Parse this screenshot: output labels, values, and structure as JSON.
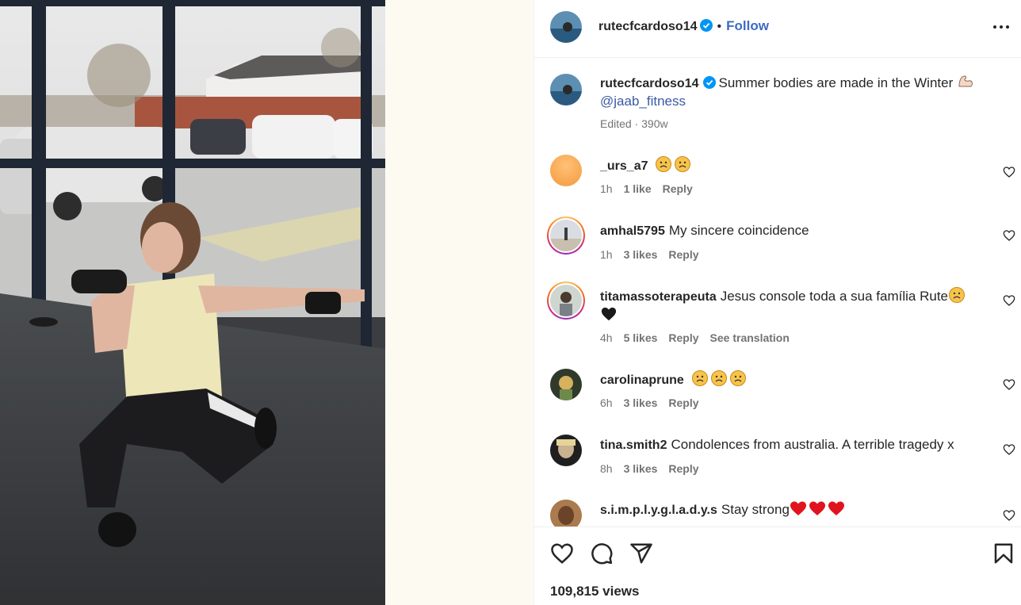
{
  "post": {
    "author": "rutecfcardoso14",
    "follow_label": "Follow",
    "separator": "•",
    "caption": "Summer bodies are made in the Winter",
    "caption_emoji": "flexed-biceps",
    "mention": "@jaab_fitness",
    "caption_meta": "Edited · 390w"
  },
  "comments": [
    {
      "user": "_urs_a7",
      "text": "",
      "emoji": [
        "sad-face",
        "sad-face"
      ],
      "time": "1h",
      "likes": "1 like",
      "reply": "Reply",
      "extra": ""
    },
    {
      "user": "amhal5795",
      "text": "My sincere coincidence",
      "emoji": [],
      "time": "1h",
      "likes": "3 likes",
      "reply": "Reply",
      "extra": ""
    },
    {
      "user": "titamassoterapeuta",
      "text": "Jesus console toda a sua família Rute",
      "emoji": [
        "sad-face",
        "black-heart"
      ],
      "time": "4h",
      "likes": "5 likes",
      "reply": "Reply",
      "extra": "See translation"
    },
    {
      "user": "carolinaprune",
      "text": "",
      "emoji": [
        "sad-face",
        "sad-face",
        "sad-face"
      ],
      "time": "6h",
      "likes": "3 likes",
      "reply": "Reply",
      "extra": ""
    },
    {
      "user": "tina.smith2",
      "text": "Condolences from australia. A terrible tragedy x",
      "emoji": [],
      "time": "8h",
      "likes": "3 likes",
      "reply": "Reply",
      "extra": ""
    },
    {
      "user": "s.i.m.p.l.y.g.l.a.d.y.s",
      "text": "Stay strong",
      "emoji": [
        "red-heart",
        "red-heart",
        "red-heart"
      ],
      "time": "",
      "likes": "",
      "reply": "",
      "extra": ""
    }
  ],
  "stats": {
    "views": "109,815 views"
  },
  "icons": {
    "more": "more-options-icon",
    "like": "heart-icon",
    "comment": "comment-icon",
    "share": "share-icon",
    "save": "bookmark-icon",
    "verified": "verified-badge-icon"
  },
  "colors": {
    "link": "#3b59a5",
    "verified": "#0095f6",
    "meta": "#737373",
    "text": "#262626"
  }
}
